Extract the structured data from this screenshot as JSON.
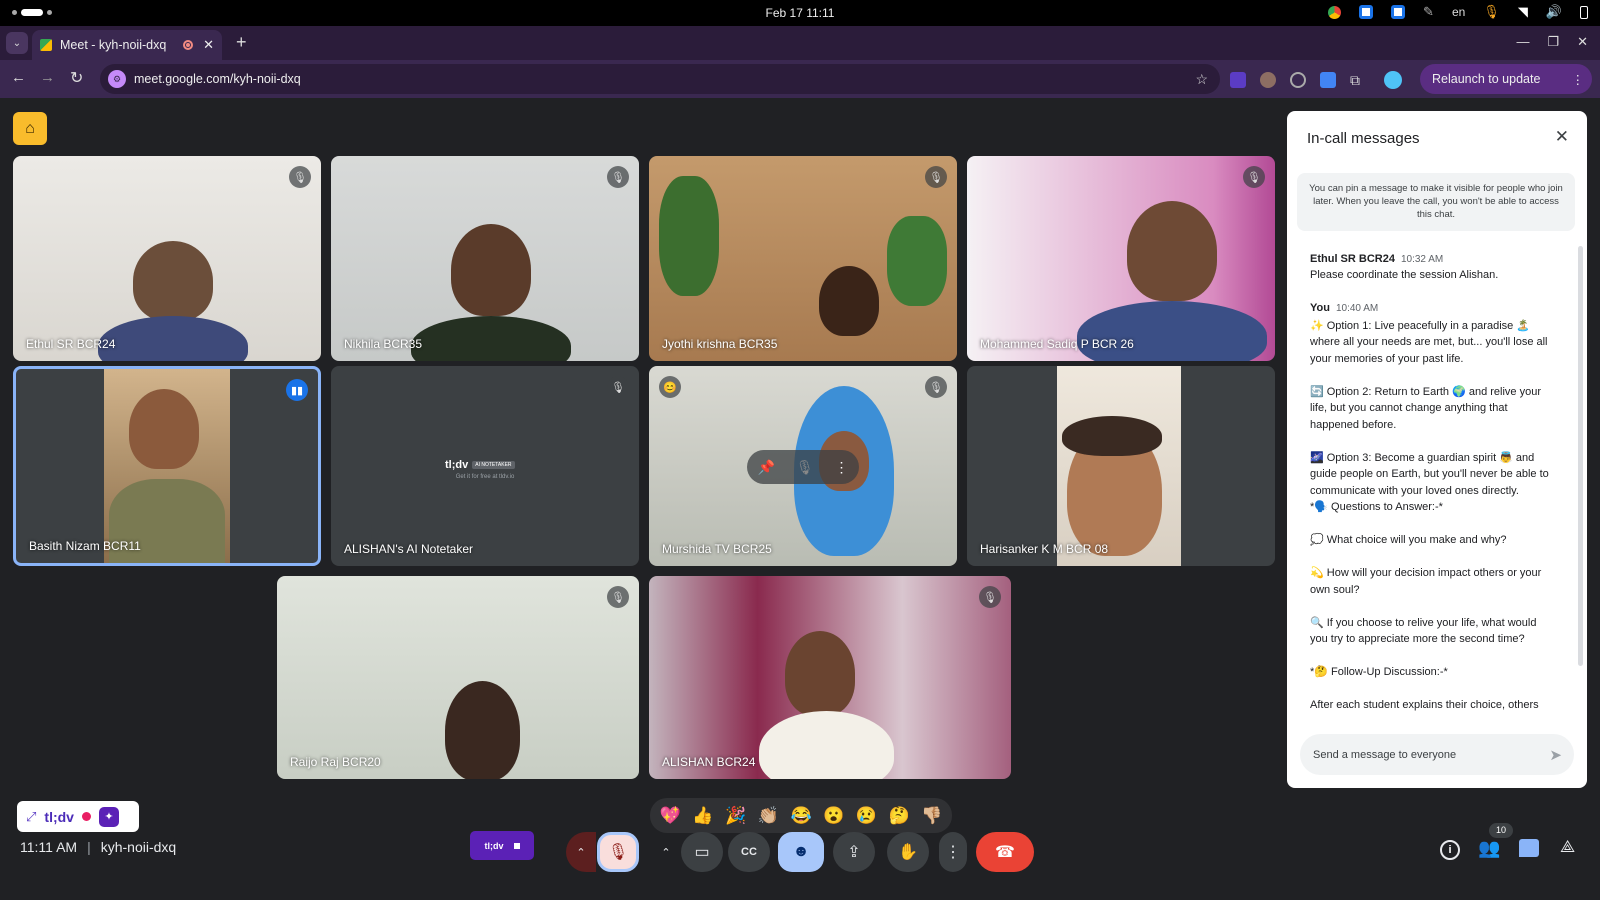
{
  "os": {
    "datetime": "Feb 17  11:11",
    "lang": "en"
  },
  "browser": {
    "tab_title": "Meet - kyh-noii-dxq",
    "new_tab": "+",
    "url": "meet.google.com/kyh-noii-dxq",
    "relaunch": "Relaunch to update"
  },
  "meeting": {
    "tiles": [
      {
        "name": "Ethul SR BCR24",
        "muted": true
      },
      {
        "name": "Nikhila BCR35",
        "muted": true
      },
      {
        "name": "Jyothi krishna BCR35",
        "muted": true
      },
      {
        "name": "Mohammed Sadiq P BCR 26",
        "muted": true
      },
      {
        "name": "Basith Nizam BCR11",
        "muted": false
      },
      {
        "name": "ALISHAN's AI Notetaker",
        "muted": true
      },
      {
        "name": "Murshida TV BCR25",
        "muted": true
      },
      {
        "name": "Harisanker K M BCR 08",
        "muted": false
      },
      {
        "name": "Raijo Raj BCR20",
        "muted": true
      },
      {
        "name": "ALISHAN BCR24",
        "muted": true
      }
    ],
    "notetaker": {
      "logo": "tl;dv",
      "badge": "AI NOTETAKER",
      "tagline": "Get it for free at tldv.io"
    },
    "time": "11:11 AM",
    "code": "kyh-noii-dxq",
    "tldv_widget": "tl;dv",
    "tldv_button": "tl;dv",
    "participants_count": "10",
    "reactions": [
      "💖",
      "👍",
      "🎉",
      "👏🏼",
      "😂",
      "😮",
      "😢",
      "🤔",
      "👎🏼"
    ]
  },
  "chat": {
    "title": "In-call messages",
    "notice": "You can pin a message to make it visible for people who join later. When you leave the call, you won't be able to access this chat.",
    "messages": [
      {
        "sender": "Ethul SR BCR24",
        "time": "10:32 AM",
        "lines": [
          "Please coordinate the session Alishan."
        ]
      },
      {
        "sender": "You",
        "time": "10:40 AM",
        "lines": [
          "✨ Option 1: Live peacefully in a paradise 🏝️",
          "where all your needs are met, but... you'll lose all",
          "your memories of your past life.",
          "",
          "🔄 Option 2: Return to Earth 🌍 and relive your",
          "life, but you cannot change anything that",
          "happened before.",
          "",
          "🌌 Option 3: Become a guardian spirit 👼 and",
          "guide people on Earth, but you'll never be able to",
          "communicate with your loved ones directly.",
          "*🗣️ Questions to Answer:-*",
          "",
          "💭 What choice will you make and why?",
          "",
          "💫 How will your decision impact others or your",
          "own soul?",
          "",
          "🔍 If you choose to relive your life, what would",
          "you try to appreciate more the second time?",
          "",
          "*🤔 Follow-Up Discussion:-*",
          "",
          "After each student explains their choice, others"
        ]
      }
    ],
    "input_placeholder": "Send a message to everyone"
  }
}
